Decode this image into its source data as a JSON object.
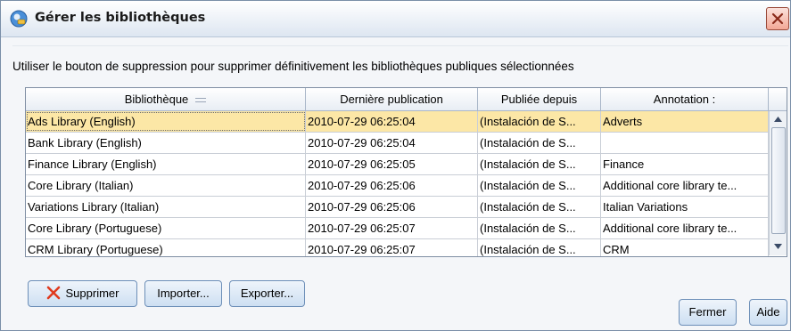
{
  "window": {
    "title": "Gérer les bibliothèques",
    "title_icon": "library-globe-icon",
    "close_icon": "close-x-icon",
    "accent_color": "#d9432b"
  },
  "instructions": "Utiliser le bouton de suppression pour supprimer définitivement les bibliothèques publiques sélectionnées",
  "table": {
    "columns": [
      "Bibliothèque",
      "Dernière publication",
      "Publiée depuis",
      "Annotation :"
    ],
    "sort_icon": "sort-indicator-icon",
    "rows": [
      {
        "name": "Ads Library (English)",
        "date": "2010-07-29 06:25:04",
        "source": "(Instalación de S...",
        "note": "Adverts",
        "selected": true
      },
      {
        "name": "Bank Library (English)",
        "date": "2010-07-29 06:25:04",
        "source": "(Instalación de S...",
        "note": ""
      },
      {
        "name": "Finance Library (English)",
        "date": "2010-07-29 06:25:05",
        "source": "(Instalación de S...",
        "note": "Finance"
      },
      {
        "name": "Core Library (Italian)",
        "date": "2010-07-29 06:25:06",
        "source": "(Instalación de S...",
        "note": "Additional core library te..."
      },
      {
        "name": "Variations Library (Italian)",
        "date": "2010-07-29 06:25:06",
        "source": "(Instalación de S...",
        "note": "Italian Variations"
      },
      {
        "name": "Core Library (Portuguese)",
        "date": "2010-07-29 06:25:07",
        "source": "(Instalación de S...",
        "note": "Additional core library te..."
      },
      {
        "name": "CRM Library (Portuguese)",
        "date": "2010-07-29 06:25:07",
        "source": "(Instalación de S...",
        "note": "CRM"
      }
    ],
    "selected_row_color": "#fce7a6"
  },
  "buttons": {
    "delete": "Supprimer",
    "delete_icon": "red-x-icon",
    "import": "Importer...",
    "export": "Exporter...",
    "close": "Fermer",
    "help": "Aide"
  }
}
